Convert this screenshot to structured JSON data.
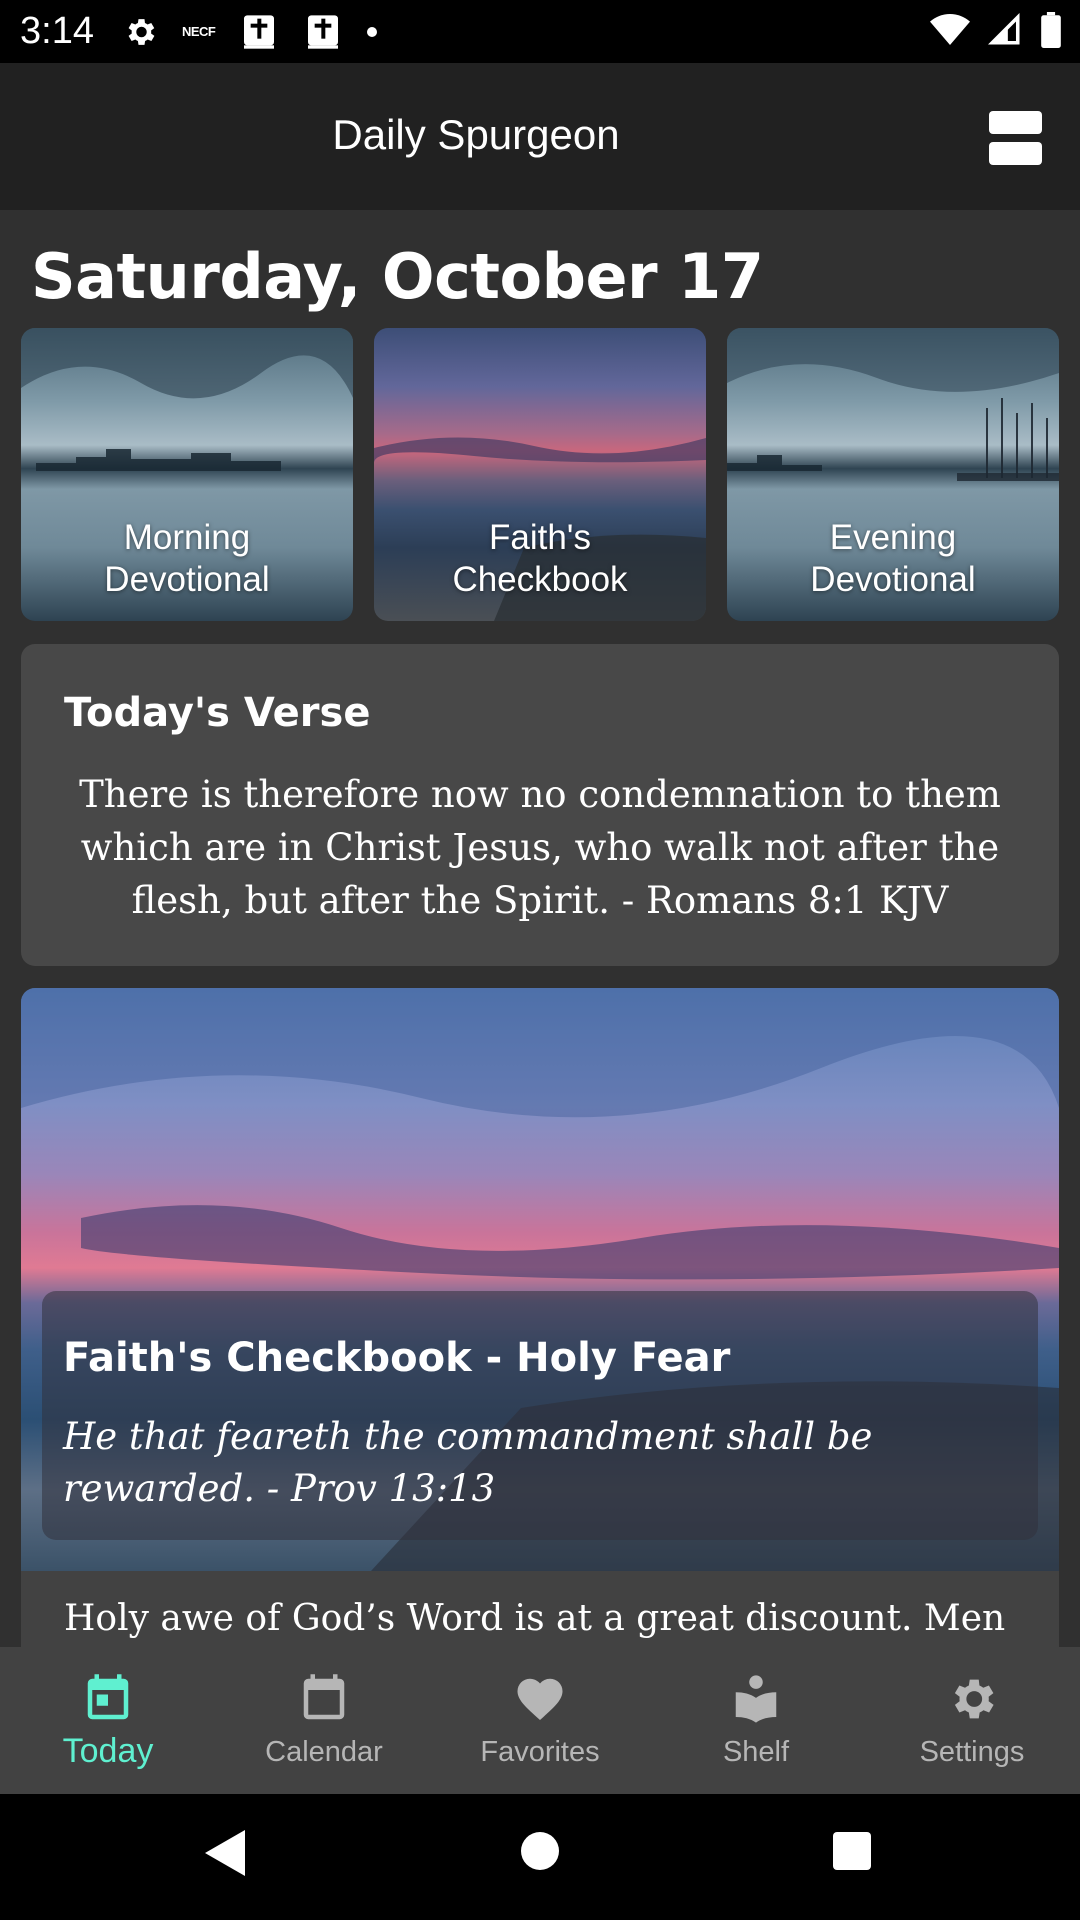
{
  "status_bar": {
    "time": "3:14",
    "left_icons": [
      "gear-icon",
      "necf-icon",
      "bible-icon",
      "bible-icon",
      "dot-icon"
    ],
    "necf_text": "NECF",
    "right_icons": [
      "wifi-icon",
      "signal-icon",
      "battery-icon"
    ]
  },
  "app_bar": {
    "title": "Daily Spurgeon",
    "menu_icon": "view-agenda-icon"
  },
  "date_heading": "Saturday, October 17",
  "tiles": [
    {
      "label_line1": "Morning",
      "label_line2": "Devotional"
    },
    {
      "label_line1": "Faith's",
      "label_line2": "Checkbook"
    },
    {
      "label_line1": "Evening",
      "label_line2": "Devotional"
    }
  ],
  "verse_card": {
    "title": "Today's Verse",
    "text": "There is therefore now no condemnation to them which are in Christ Jesus, who walk not after the flesh, but after the Spirit. - Romans 8:1 KJV"
  },
  "feature_card": {
    "title": "Faith's Checkbook - Holy Fear",
    "quote": "He that feareth the commandment shall be rewarded. - Prov 13:13",
    "body": "Holy awe of God’s Word is at a great discount. Men think themselves wiser than the Word of the Lord and"
  },
  "bottom_nav": {
    "items": [
      {
        "label": "Today",
        "icon": "calendar-today-icon",
        "active": true
      },
      {
        "label": "Calendar",
        "icon": "calendar-icon",
        "active": false
      },
      {
        "label": "Favorites",
        "icon": "heart-icon",
        "active": false
      },
      {
        "label": "Shelf",
        "icon": "reader-icon",
        "active": false
      },
      {
        "label": "Settings",
        "icon": "gear-icon",
        "active": false
      }
    ]
  },
  "colors": {
    "accent": "#5ff0d0",
    "app_bar": "#212121",
    "background": "#303030",
    "card": "#484848",
    "nav_background": "#424242"
  }
}
